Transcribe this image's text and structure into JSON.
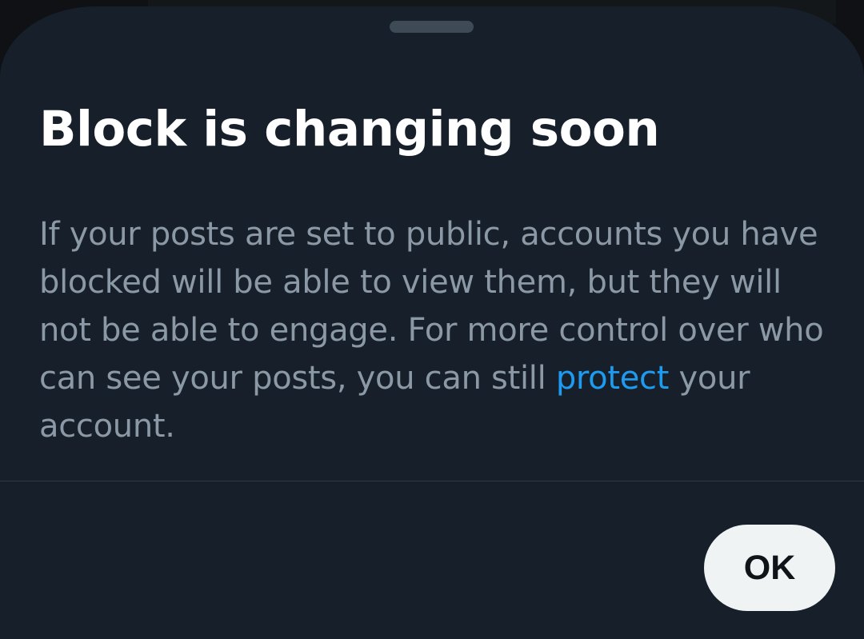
{
  "dialog": {
    "title": "Block is changing soon",
    "body_text_before_link": "If your posts are set to public, accounts you have blocked will be able to view them, but they will not be able to engage. For more control over who can see your posts, you can still ",
    "link_label": "protect",
    "body_text_after_link": " your account.",
    "ok_label": "OK"
  },
  "colors": {
    "sheet_background": "#17202a",
    "title": "#ffffff",
    "body_text": "#8b98a5",
    "link": "#1d9bf0",
    "ok_button_background": "#eff3f4",
    "ok_button_text": "#0f1419"
  }
}
